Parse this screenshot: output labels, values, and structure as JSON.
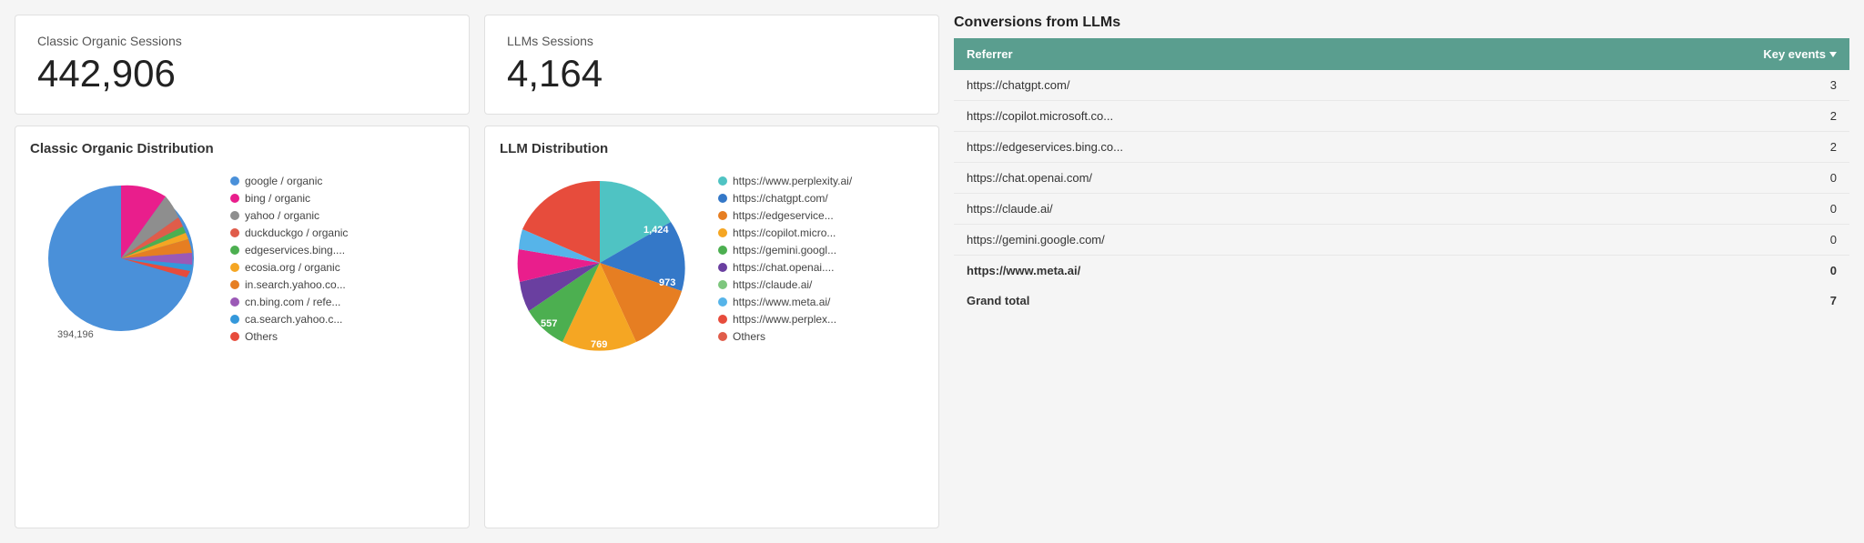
{
  "leftStat": {
    "label": "Classic Organic Sessions",
    "value": "442,906"
  },
  "middleStat": {
    "label": "LLMs Sessions",
    "value": "4,164"
  },
  "classicChart": {
    "title": "Classic Organic Distribution",
    "mainValue": "394,196",
    "legend": [
      {
        "label": "google / organic",
        "color": "#4a90d9"
      },
      {
        "label": "bing / organic",
        "color": "#e91e8c"
      },
      {
        "label": "yahoo / organic",
        "color": "#8e8e8e"
      },
      {
        "label": "duckduckgo / organic",
        "color": "#e05c4a"
      },
      {
        "label": "edgeservices.bing....",
        "color": "#4caf50"
      },
      {
        "label": "ecosia.org / organic",
        "color": "#f5a623"
      },
      {
        "label": "in.search.yahoo.co...",
        "color": "#e67e22"
      },
      {
        "label": "cn.bing.com / refe...",
        "color": "#9b59b6"
      },
      {
        "label": "ca.search.yahoo.c...",
        "color": "#3498db"
      },
      {
        "label": "Others",
        "color": "#e74c3c"
      }
    ],
    "slices": [
      {
        "pct": 89,
        "color": "#4a90d9"
      },
      {
        "pct": 4,
        "color": "#e91e8c"
      },
      {
        "pct": 2,
        "color": "#8e8e8e"
      },
      {
        "pct": 1,
        "color": "#e05c4a"
      },
      {
        "pct": 0.5,
        "color": "#4caf50"
      },
      {
        "pct": 0.5,
        "color": "#f5a623"
      },
      {
        "pct": 1,
        "color": "#e67e22"
      },
      {
        "pct": 1,
        "color": "#9b59b6"
      },
      {
        "pct": 0.5,
        "color": "#3498db"
      },
      {
        "pct": 0.5,
        "color": "#e74c3c"
      }
    ]
  },
  "llmChart": {
    "title": "LLM Distribution",
    "legend": [
      {
        "label": "https://www.perplexity.ai/",
        "color": "#4fc3c3"
      },
      {
        "label": "https://chatgpt.com/",
        "color": "#3478c8"
      },
      {
        "label": "https://edgeservice...",
        "color": "#e67e22"
      },
      {
        "label": "https://copilot.micro...",
        "color": "#f5a623"
      },
      {
        "label": "https://gemini.googl...",
        "color": "#4caf50"
      },
      {
        "label": "https://chat.openai....",
        "color": "#6a3fa0"
      },
      {
        "label": "https://claude.ai/",
        "color": "#7dc67d"
      },
      {
        "label": "https://www.meta.ai/",
        "color": "#56b4e9"
      },
      {
        "label": "https://www.perplex...",
        "color": "#e74c3c"
      },
      {
        "label": "Others",
        "color": "#e05c4a"
      }
    ],
    "slices": [
      {
        "value": "1,424",
        "pct": 34,
        "color": "#4fc3c3"
      },
      {
        "value": "973",
        "pct": 23,
        "color": "#3478c8"
      },
      {
        "value": "769",
        "pct": 18,
        "color": "#e67e22"
      },
      {
        "value": "557",
        "pct": 13,
        "color": "#f5a623"
      },
      {
        "value": "",
        "pct": 4,
        "color": "#4caf50"
      },
      {
        "value": "",
        "pct": 3,
        "color": "#6a3fa0"
      },
      {
        "value": "",
        "pct": 2,
        "color": "#e91e8c"
      },
      {
        "value": "",
        "pct": 2,
        "color": "#7dc67d"
      },
      {
        "value": "",
        "pct": 1,
        "color": "#56b4e9"
      }
    ]
  },
  "conversions": {
    "title": "Conversions from LLMs",
    "header": {
      "referrer": "Referrer",
      "keyEvents": "Key events"
    },
    "rows": [
      {
        "referrer": "https://chatgpt.com/",
        "events": "3"
      },
      {
        "referrer": "https://copilot.microsoft.co...",
        "events": "2"
      },
      {
        "referrer": "https://edgeservices.bing.co...",
        "events": "2"
      },
      {
        "referrer": "https://chat.openai.com/",
        "events": "0"
      },
      {
        "referrer": "https://claude.ai/",
        "events": "0"
      },
      {
        "referrer": "https://gemini.google.com/",
        "events": "0"
      },
      {
        "referrer": "https://www.meta.ai/",
        "events": "0"
      }
    ],
    "grandTotal": {
      "label": "Grand total",
      "value": "7"
    }
  }
}
